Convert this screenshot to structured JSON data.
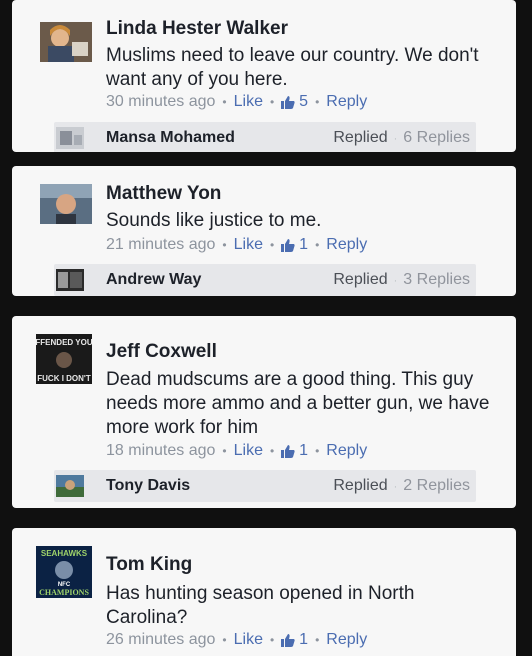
{
  "comments": [
    {
      "author": "Linda Hester Walker",
      "text": "Muslims need to leave our country. We don't want any of you here.",
      "time": "30 minutes ago",
      "like_label": "Like",
      "likes": "5",
      "reply_label": "Reply",
      "reply": {
        "author": "Mansa Mohamed",
        "status": "Replied",
        "count": "6 Replies"
      }
    },
    {
      "author": "Matthew Yon",
      "text": "Sounds like justice to me.",
      "time": "21 minutes ago",
      "like_label": "Like",
      "likes": "1",
      "reply_label": "Reply",
      "reply": {
        "author": "Andrew Way",
        "status": "Replied",
        "count": "3 Replies"
      }
    },
    {
      "author": "Jeff Coxwell",
      "avatar_text": [
        "FFENDED YOU",
        "FUCK I DON'T"
      ],
      "text": "Dead mudscums are a good thing.  This guy needs more ammo and a better gun, we have more work for him",
      "time": "18 minutes ago",
      "like_label": "Like",
      "likes": "1",
      "reply_label": "Reply",
      "reply": {
        "author": "Tony Davis",
        "status": "Replied",
        "count": "2 Replies"
      }
    },
    {
      "author": "Tom King",
      "avatar_text": [
        "SEAHAWKS",
        "NFC",
        "CHAMPIONS"
      ],
      "text": "Has hunting season opened in North Carolina?",
      "time": "26 minutes ago",
      "like_label": "Like",
      "likes": "1",
      "reply_label": "Reply"
    }
  ],
  "colors": {
    "link": "#4b6db1",
    "meta": "#8d949e",
    "card": "#f7f7f7",
    "background": "#101010",
    "reply_bar": "#e6e7ea"
  },
  "icons": [
    "thumbs-up-icon"
  ]
}
